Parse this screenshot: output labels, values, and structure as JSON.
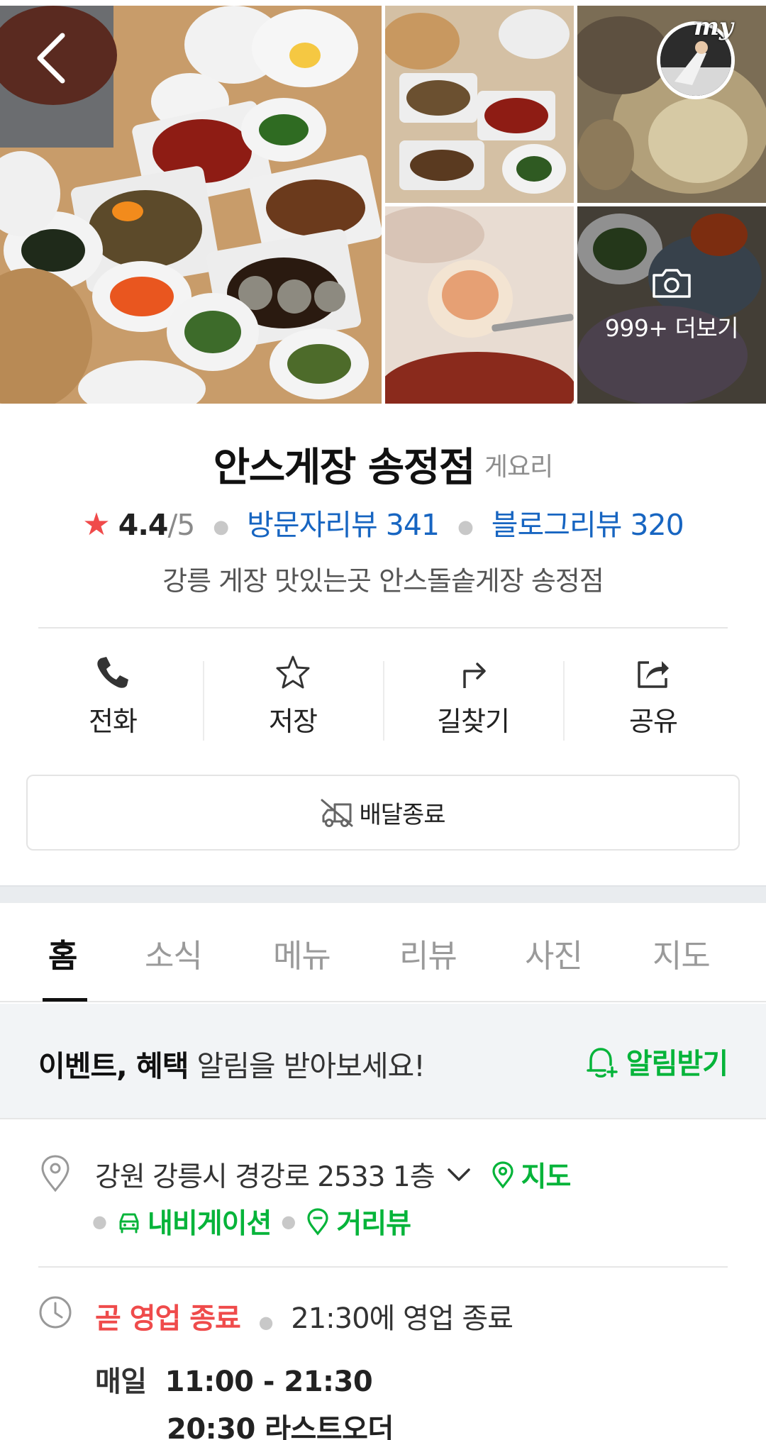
{
  "gallery": {
    "more_label": "999+ 더보기",
    "my_badge": "my",
    "icons": {
      "back": "chevron-left-icon",
      "camera": "camera-icon"
    }
  },
  "place": {
    "name": "안스게장 송정점",
    "category": "게요리",
    "rating": "4.4",
    "rating_max": "/5",
    "visitor_reviews": "방문자리뷰 341",
    "blog_reviews": "블로그리뷰 320",
    "description": "강릉 게장 맛있는곳 안스돌솥게장 송정점"
  },
  "actions": [
    {
      "label": "전화",
      "icon": "phone-icon"
    },
    {
      "label": "저장",
      "icon": "star-outline-icon"
    },
    {
      "label": "길찾기",
      "icon": "directions-icon"
    },
    {
      "label": "공유",
      "icon": "share-icon"
    }
  ],
  "delivery": {
    "label": "배달종료",
    "icon": "delivery-truck-icon"
  },
  "tabs": [
    "홈",
    "소식",
    "메뉴",
    "리뷰",
    "사진",
    "지도"
  ],
  "active_tab": "홈",
  "notice": {
    "bold_text": "이벤트, 혜택",
    "text": " 알림을 받아보세요!",
    "button_label": "알림받기"
  },
  "address": {
    "text": "강원 강릉시 경강로 2533 1층",
    "map_label": "지도",
    "navigation_label": "내비게이션",
    "street_view_label": "거리뷰"
  },
  "hours": {
    "status": "곧 영업 종료",
    "close_text": "21:30에 영업 종료",
    "day": "매일",
    "time": "11:00 - 21:30",
    "last_order": "20:30 라스트오더"
  },
  "colors": {
    "accent_green": "#06b43a",
    "link_blue": "#1765c1",
    "status_red": "#ef4b4b",
    "star_red": "#f04a4a"
  }
}
